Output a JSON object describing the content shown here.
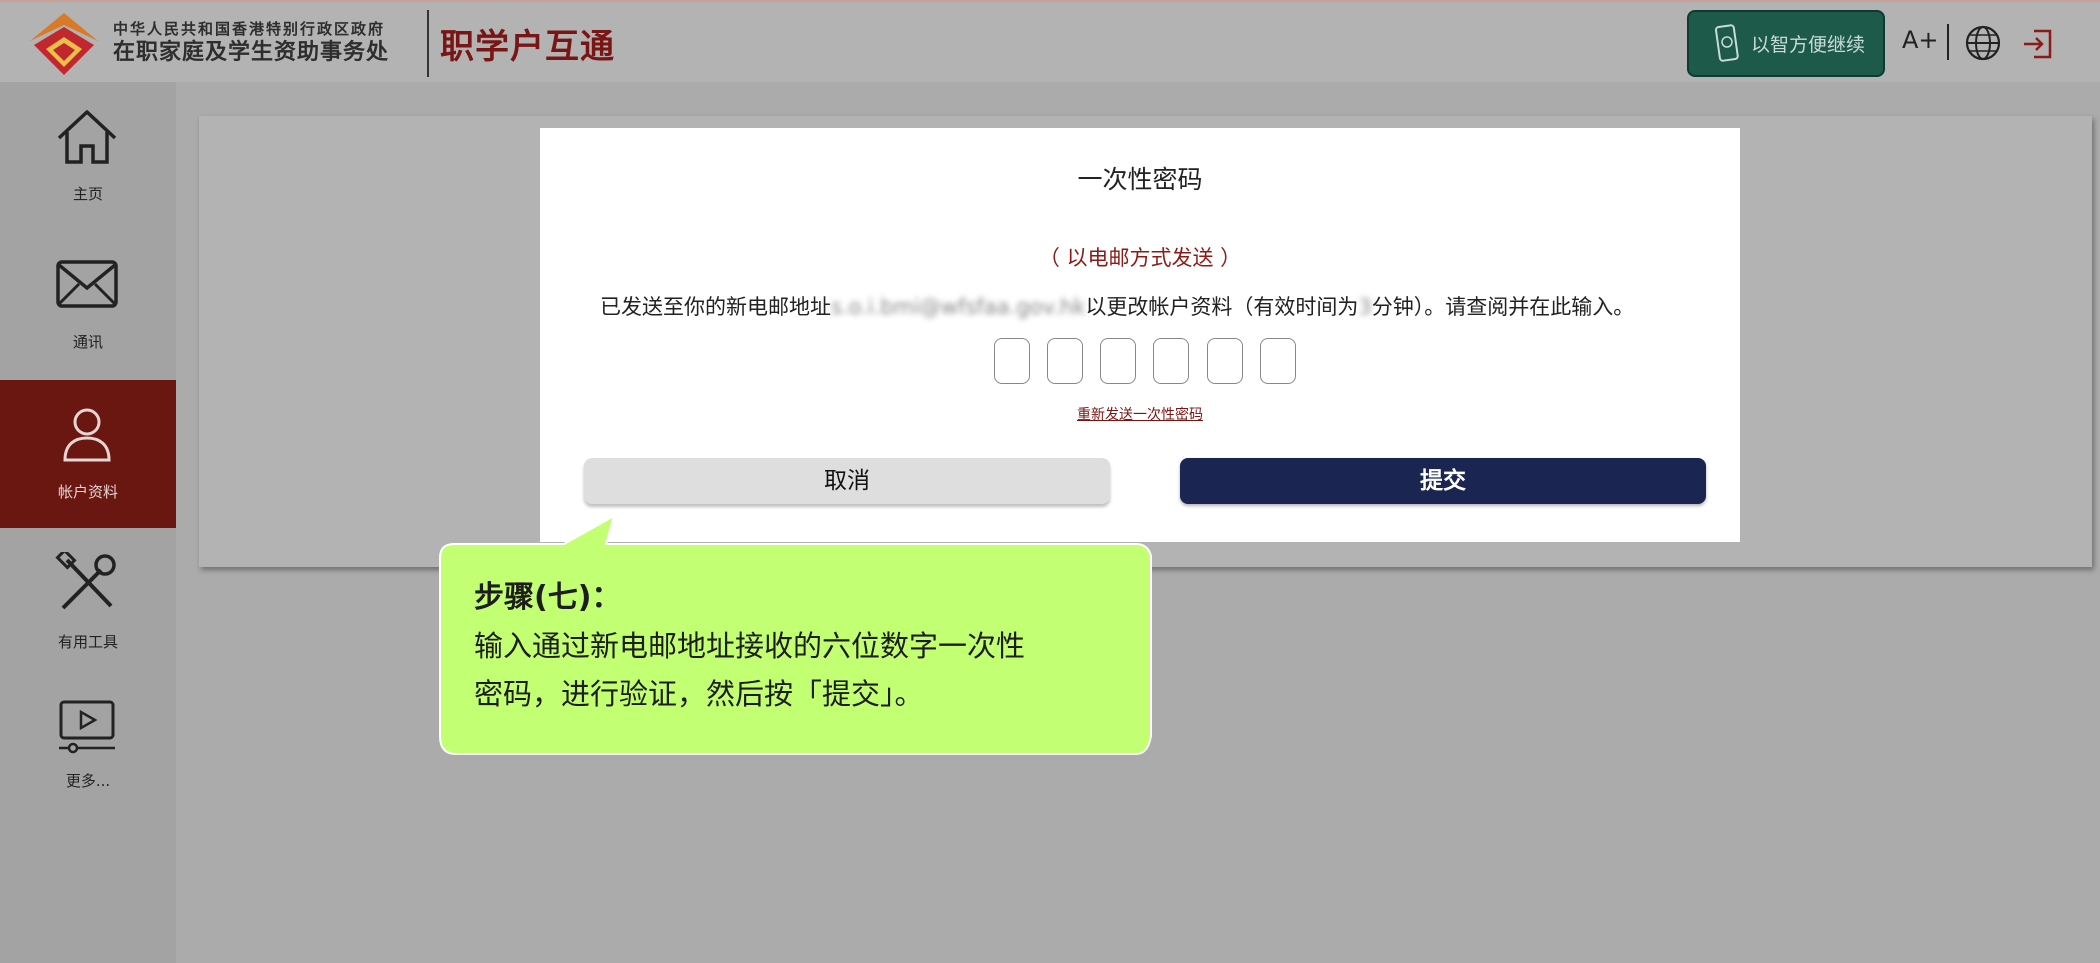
{
  "header": {
    "org_line1": "中华人民共和国香港特别行政区政府",
    "org_line2": "在职家庭及学生资助事务处",
    "app_title": "职学户互通",
    "ismart_button": "以智方便继续",
    "font_size_button": "A+",
    "globe_icon": "globe-icon",
    "logout_icon": "logout-icon"
  },
  "sidebar": {
    "items": [
      {
        "label": "主页",
        "icon": "home-icon"
      },
      {
        "label": "通讯",
        "icon": "mail-icon"
      },
      {
        "label": "帐户资料",
        "icon": "user-icon",
        "active": true
      },
      {
        "label": "有用工具",
        "icon": "tools-icon"
      },
      {
        "label": "更多...",
        "icon": "video-icon"
      }
    ]
  },
  "dialog": {
    "title": "一次性密码",
    "subtitle": "（ 以电邮方式发送 ）",
    "message_prefix": "已发送至你的新电邮地址",
    "message_email": "s.o.i.bmi@wfsfaa.gov.hk",
    "message_middle": "以更改帐户资料（有效时间为",
    "message_minutes": "3",
    "message_suffix": "分钟）。请查阅并在此输入。",
    "otp_digits": [
      "",
      "",
      "",
      "",
      "",
      ""
    ],
    "resend_link": "重新发送一次性密码",
    "cancel_button": "取消",
    "submit_button": "提交"
  },
  "callout": {
    "title": "步骤(七)：",
    "line1": "输入通过新电邮地址接收的六位数字一次性",
    "line2": "密码，进行验证，然后按「提交」。",
    "color": "#c2ff72"
  },
  "colors": {
    "brand_red": "#7a1515",
    "sidebar_active": "#6a1712",
    "submit_blue": "#1a2552",
    "ismart_green": "#1d5a4a"
  }
}
